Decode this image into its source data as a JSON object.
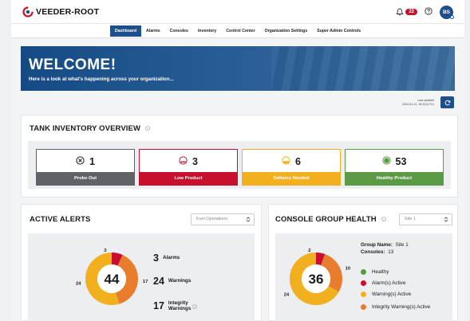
{
  "header": {
    "brand": "VEEDER-ROOT",
    "notification_count": "22",
    "user_initials": "BS",
    "icons": [
      "bell-icon",
      "help-icon"
    ]
  },
  "nav": {
    "tabs": [
      {
        "label": "Dashboard",
        "active": true
      },
      {
        "label": "Alarms",
        "active": false
      },
      {
        "label": "Consoles",
        "active": false
      },
      {
        "label": "Inventory",
        "active": false
      },
      {
        "label": "Control Center",
        "active": false
      },
      {
        "label": "Organization Settings",
        "active": false
      },
      {
        "label": "Super Admin Controls",
        "active": false
      }
    ]
  },
  "banner": {
    "title": "WELCOME!",
    "subtitle": "Here is a look at what's happening across your organization..."
  },
  "last_updated": {
    "label": "Last updated",
    "value": "2024-01-11, 16:25 (UTC)"
  },
  "tank_inventory": {
    "title": "TANK INVENTORY OVERVIEW",
    "tiles": [
      {
        "count": "1",
        "label": "Probe Out",
        "color": "#5f6368",
        "icon": "x-circle-icon"
      },
      {
        "count": "3",
        "label": "Low Product",
        "color": "#c8102e",
        "icon": "low-product-icon"
      },
      {
        "count": "6",
        "label": "Delivery Needed",
        "color": "#f2b01e",
        "icon": "delivery-needed-icon"
      },
      {
        "count": "53",
        "label": "Healthy Product",
        "color": "#5b9a45",
        "icon": "healthy-product-icon"
      }
    ]
  },
  "active_alerts": {
    "title": "ACTIVE ALERTS",
    "filter_value": "Fuel Operations",
    "total": "44",
    "segments": [
      {
        "name": "Alarms",
        "value": 3,
        "color": "#c8102e"
      },
      {
        "name": "Integrity Warnings",
        "value": 17,
        "color": "#e87d2e"
      },
      {
        "name": "Warnings",
        "value": 24,
        "color": "#f2b01e"
      }
    ],
    "stats": [
      {
        "count": "3",
        "label": "Alarms"
      },
      {
        "count": "24",
        "label": "Warnings"
      },
      {
        "count": "17",
        "label_line1": "Integrity",
        "label_line2": "Warnings"
      }
    ]
  },
  "console_health": {
    "title": "CONSOLE GROUP HEALTH",
    "filter_value": "Site 1",
    "group_name_label": "Group Name:",
    "group_name": "Site 1",
    "consoles_label": "Consoles:",
    "consoles": "13",
    "total": "36",
    "segments": [
      {
        "name": "Alarm(s) Active",
        "value": 2,
        "color": "#c8102e"
      },
      {
        "name": "Integrity Warning(s) Active",
        "value": 10,
        "color": "#e87d2e"
      },
      {
        "name": "Warning(s) Active",
        "value": 24,
        "color": "#f2b01e"
      }
    ],
    "legend": [
      {
        "label": "Healthy",
        "color": "#5b9a45"
      },
      {
        "label": "Alarm(s) Active",
        "color": "#c8102e"
      },
      {
        "label": "Warning(s) Active",
        "color": "#f2b01e"
      },
      {
        "label": "Integrity Warning(s) Active",
        "color": "#e87d2e"
      }
    ]
  }
}
